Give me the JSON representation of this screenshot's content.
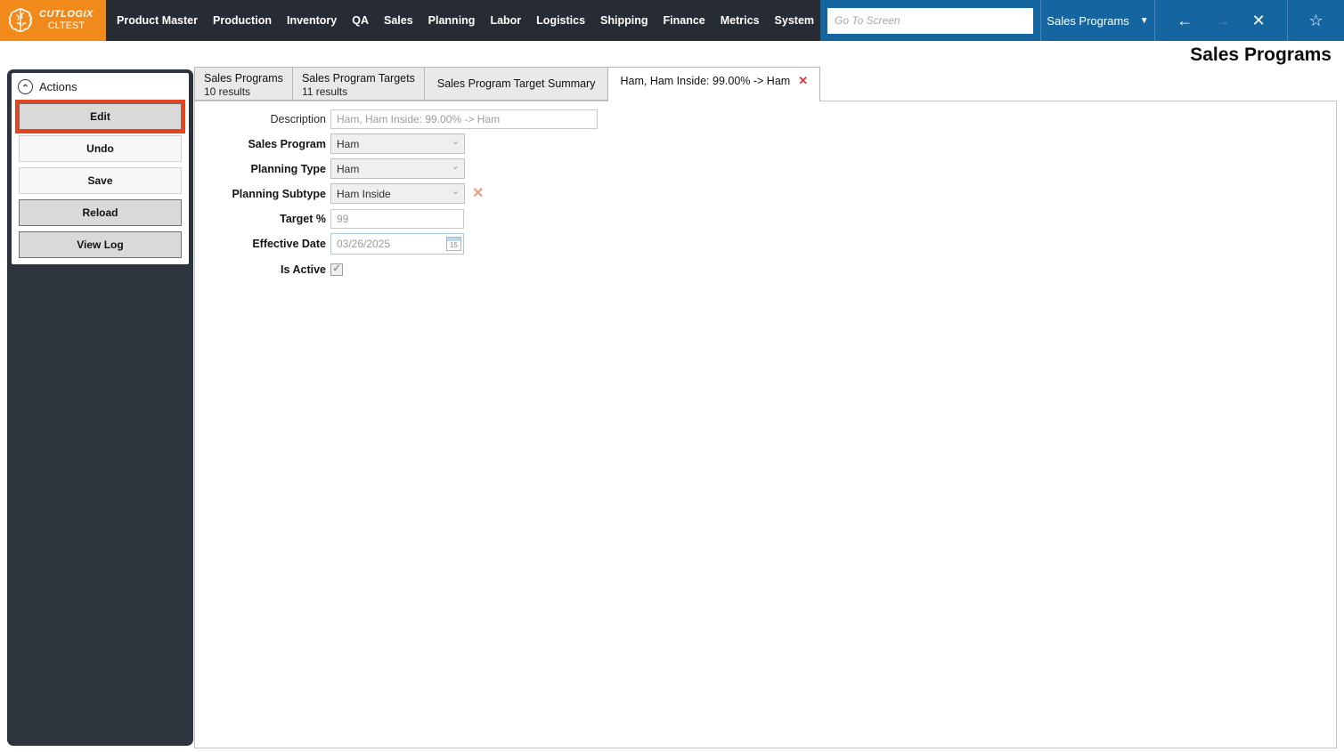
{
  "brand": {
    "name": "CUTLOGIX",
    "environment": "CLTEST"
  },
  "nav": {
    "items": [
      "Product Master",
      "Production",
      "Inventory",
      "QA",
      "Sales",
      "Planning",
      "Labor",
      "Logistics",
      "Shipping",
      "Finance",
      "Metrics",
      "System"
    ]
  },
  "topbar": {
    "goto_placeholder": "Go To Screen",
    "screen_select_value": "Sales Programs"
  },
  "icons": {
    "back": "←",
    "forward": "→",
    "close": "✕",
    "favorite": "☆",
    "screen_dropdown": "▼",
    "collapse": "⌃",
    "combo_chevron": "⌄",
    "clear": "✕",
    "tab_close": "✕",
    "check": "✓",
    "calendar_day": "15"
  },
  "page": {
    "title": "Sales Programs"
  },
  "actions": {
    "header": "Actions",
    "buttons": [
      {
        "label": "Edit",
        "highlighted": true
      },
      {
        "label": "Undo",
        "highlighted": false
      },
      {
        "label": "Save",
        "highlighted": false
      },
      {
        "label": "Reload",
        "highlighted": false
      },
      {
        "label": "View Log",
        "highlighted": false
      }
    ]
  },
  "tabs": [
    {
      "title": "Sales Programs",
      "subtitle": "10 results",
      "active": false
    },
    {
      "title": "Sales Program Targets",
      "subtitle": "11 results",
      "active": false
    },
    {
      "title": "Sales Program Target Summary",
      "subtitle": "",
      "active": false
    },
    {
      "title": "Ham, Ham Inside: 99.00% -> Ham",
      "subtitle": "",
      "active": true,
      "closable": true
    }
  ],
  "form": {
    "fields": [
      {
        "label": "Description",
        "type": "text",
        "value": "Ham, Ham Inside: 99.00% -> Ham"
      },
      {
        "label": "Sales Program",
        "type": "select",
        "value": "Ham"
      },
      {
        "label": "Planning Type",
        "type": "select",
        "value": "Ham"
      },
      {
        "label": "Planning Subtype",
        "type": "select",
        "value": "Ham Inside",
        "clearable": true
      },
      {
        "label": "Target %",
        "type": "text",
        "value": "99"
      },
      {
        "label": "Effective Date",
        "type": "date",
        "value": "03/26/2025"
      },
      {
        "label": "Is Active",
        "type": "checkbox",
        "checked": true
      }
    ]
  },
  "colors": {
    "brand_orange": "#f28a1b",
    "topbar_dark": "#272b33",
    "topbar_blue": "#1565a0",
    "panel_dark": "#2e343d",
    "highlight_border": "#e5431e",
    "tab_close_red": "#e03535",
    "clear_salmon": "#f29b85"
  }
}
